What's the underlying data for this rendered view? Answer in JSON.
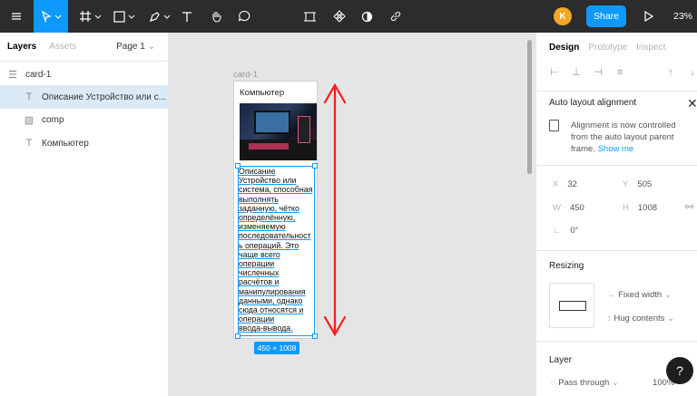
{
  "toolbar": {
    "avatar_initial": "K",
    "share_label": "Share",
    "zoom": "23%"
  },
  "left_panel": {
    "tabs": [
      "Layers",
      "Assets"
    ],
    "page": "Page 1",
    "layers": [
      {
        "name": "card-1",
        "icon": "frame-icon"
      },
      {
        "name": "Описание Устройство или с...",
        "icon": "text-icon"
      },
      {
        "name": "comp",
        "icon": "image-icon"
      },
      {
        "name": "Компьютер",
        "icon": "text-icon"
      }
    ]
  },
  "canvas": {
    "frame_label": "card-1",
    "card_title": "Компьютер",
    "description_lines": [
      "Описание",
      "Устройство или",
      "система, способная",
      "выполнять",
      "заданную, чётко",
      "определённую,",
      "изменяемую",
      "последовательност",
      "ь операций. Это",
      "чаще всего",
      "операции",
      "численных",
      "расчётов и",
      "манипулирования",
      "данными, однако",
      "сюда относятся и",
      "операции",
      "ввода-вывода."
    ],
    "size_badge": "450 × 1008",
    "accent": "#0d99ff",
    "annotation_color": "#ff1a1a"
  },
  "right_panel": {
    "tabs": [
      "Design",
      "Prototype",
      "Inspect"
    ],
    "auto_layout_title": "Auto layout alignment",
    "info_text": "Alignment is now controlled from the auto layout parent frame.",
    "info_link": "Show me",
    "x_label": "X",
    "x": "32",
    "y_label": "Y",
    "y": "505",
    "w_label": "W",
    "w": "450",
    "h_label": "H",
    "h": "1008",
    "rotation": "0°",
    "resizing_title": "Resizing",
    "fixed_width": "Fixed width",
    "hug_contents": "Hug contents",
    "layer_title": "Layer",
    "blend": "Pass through",
    "opacity": "100%"
  },
  "help": "?"
}
